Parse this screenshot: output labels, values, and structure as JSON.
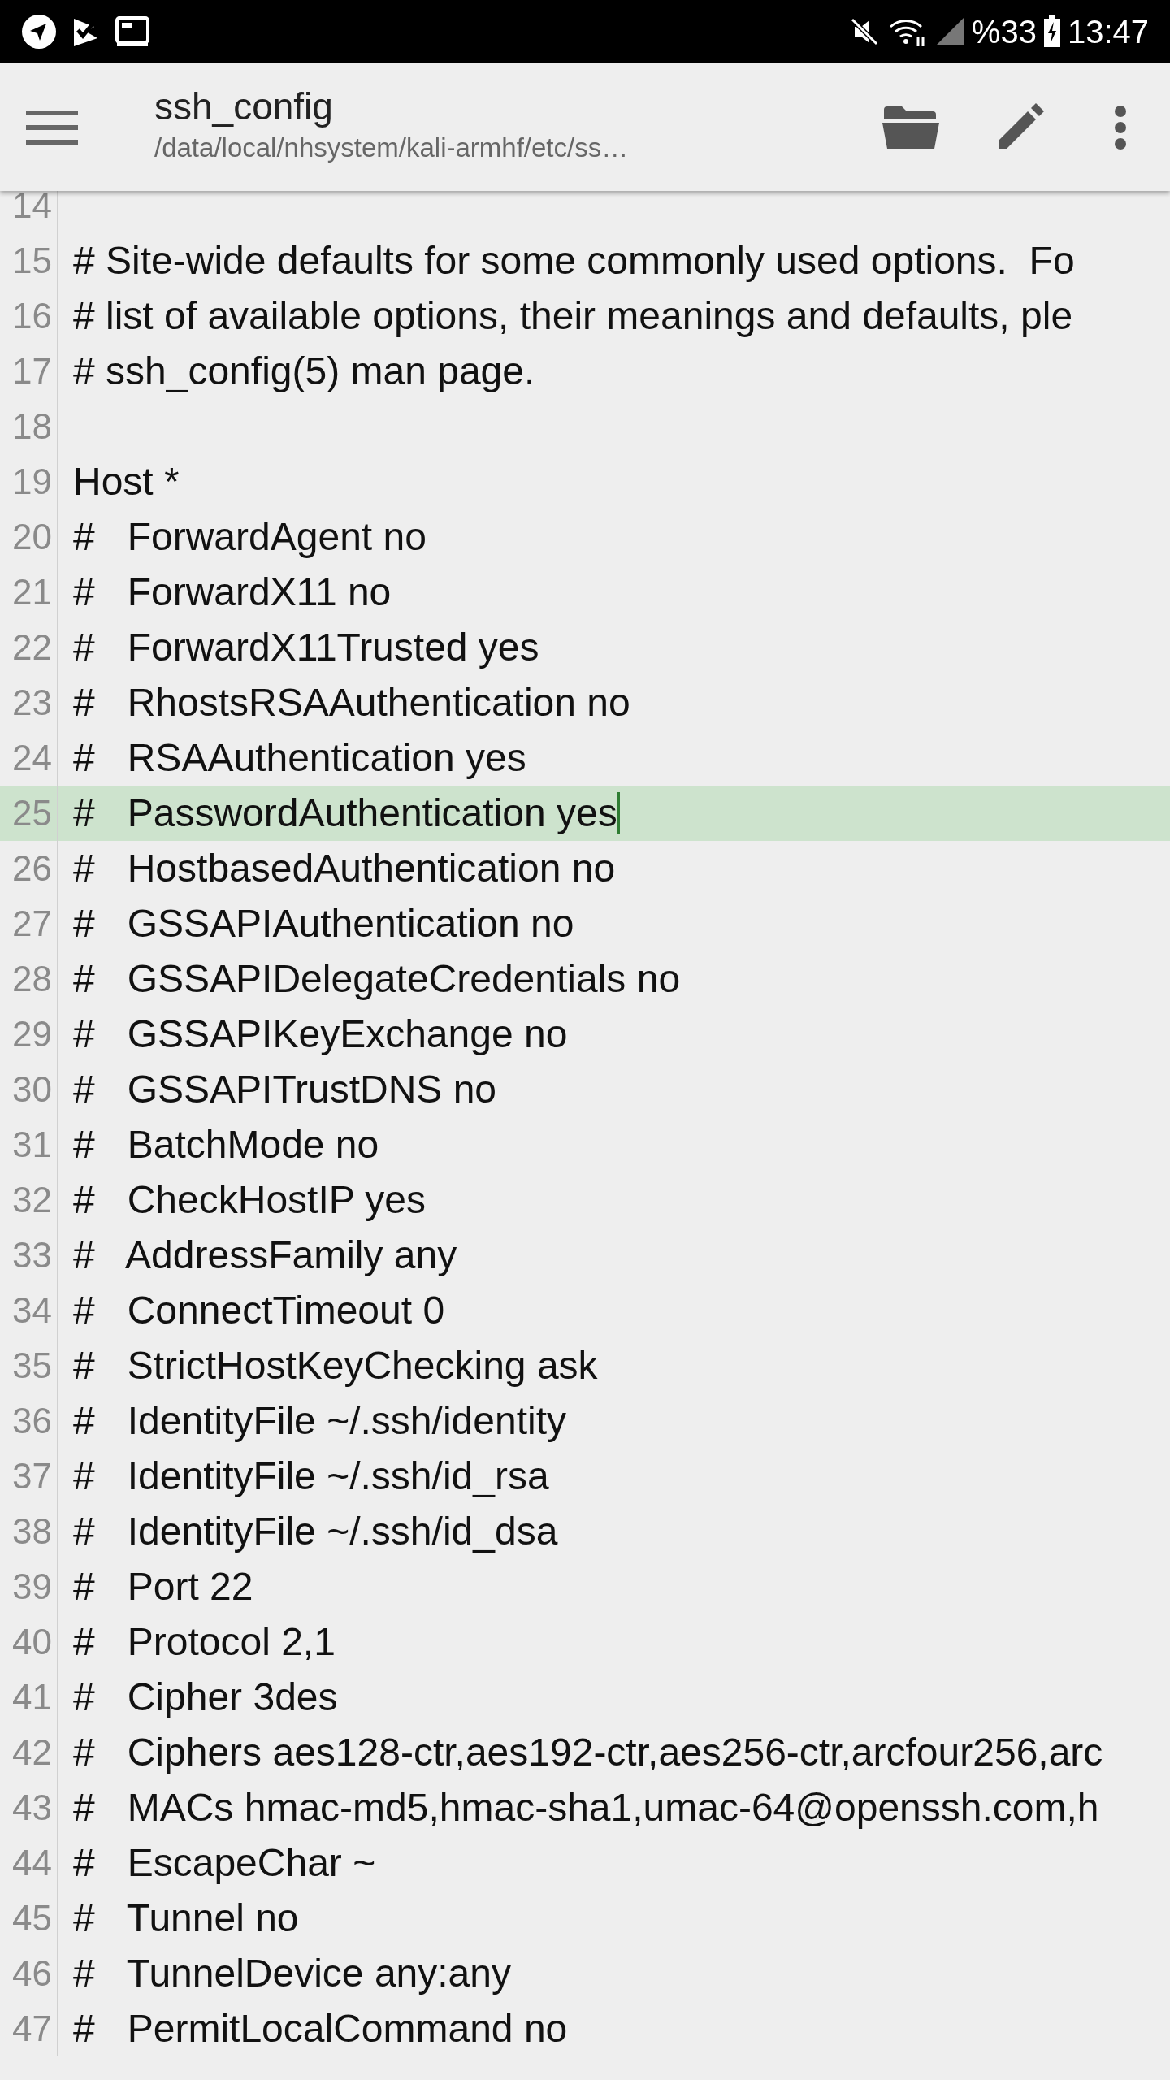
{
  "status_bar": {
    "battery": "%33",
    "time": "13:47"
  },
  "toolbar": {
    "title": "ssh_config",
    "path": "/data/local/nhsystem/kali-armhf/etc/ss…"
  },
  "editor": {
    "lines": [
      {
        "number": "14",
        "current": false
      },
      {
        "number": "15",
        "text": "# Site-wide defaults for some commonly used options.  Fo",
        "current": false
      },
      {
        "number": "16",
        "text": "# list of available options, their meanings and defaults, ple",
        "current": false
      },
      {
        "number": "17",
        "text": "# ssh_config(5) man page.",
        "current": false
      },
      {
        "number": "18",
        "current": false
      },
      {
        "number": "19",
        "text": "Host *",
        "current": false
      },
      {
        "number": "20",
        "text": "#   ForwardAgent no",
        "current": false
      },
      {
        "number": "21",
        "text": "#   ForwardX11 no",
        "current": false
      },
      {
        "number": "22",
        "text": "#   ForwardX11Trusted yes",
        "current": false
      },
      {
        "number": "23",
        "text": "#   RhostsRSAAuthentication no",
        "current": false
      },
      {
        "number": "24",
        "text": "#   RSAAuthentication yes",
        "current": false
      },
      {
        "number": "25",
        "text": "#   PasswordAuthentication yes",
        "current": true
      },
      {
        "number": "26",
        "text": "#   HostbasedAuthentication no",
        "current": false
      },
      {
        "number": "27",
        "text": "#   GSSAPIAuthentication no",
        "current": false
      },
      {
        "number": "28",
        "text": "#   GSSAPIDelegateCredentials no",
        "current": false
      },
      {
        "number": "29",
        "text": "#   GSSAPIKeyExchange no",
        "current": false
      },
      {
        "number": "30",
        "text": "#   GSSAPITrustDNS no",
        "current": false
      },
      {
        "number": "31",
        "text": "#   BatchMode no",
        "current": false
      },
      {
        "number": "32",
        "text": "#   CheckHostIP yes",
        "current": false
      },
      {
        "number": "33",
        "text": "#   AddressFamily any",
        "current": false
      },
      {
        "number": "34",
        "text": "#   ConnectTimeout 0",
        "current": false
      },
      {
        "number": "35",
        "text": "#   StrictHostKeyChecking ask",
        "current": false
      },
      {
        "number": "36",
        "text": "#   IdentityFile ~/.ssh/identity",
        "current": false
      },
      {
        "number": "37",
        "text": "#   IdentityFile ~/.ssh/id_rsa",
        "current": false
      },
      {
        "number": "38",
        "text": "#   IdentityFile ~/.ssh/id_dsa",
        "current": false
      },
      {
        "number": "39",
        "text": "#   Port 22",
        "current": false
      },
      {
        "number": "40",
        "text": "#   Protocol 2,1",
        "current": false
      },
      {
        "number": "41",
        "text": "#   Cipher 3des",
        "current": false
      },
      {
        "number": "42",
        "text": "#   Ciphers aes128-ctr,aes192-ctr,aes256-ctr,arcfour256,arc",
        "current": false
      },
      {
        "number": "43",
        "text": "#   MACs hmac-md5,hmac-sha1,umac-64@openssh.com,h",
        "current": false
      },
      {
        "number": "44",
        "text": "#   EscapeChar ~",
        "current": false
      },
      {
        "number": "45",
        "text": "#   Tunnel no",
        "current": false
      },
      {
        "number": "46",
        "text": "#   TunnelDevice any:any",
        "current": false
      },
      {
        "number": "47",
        "text": "#   PermitLocalCommand no",
        "current": false
      }
    ]
  }
}
